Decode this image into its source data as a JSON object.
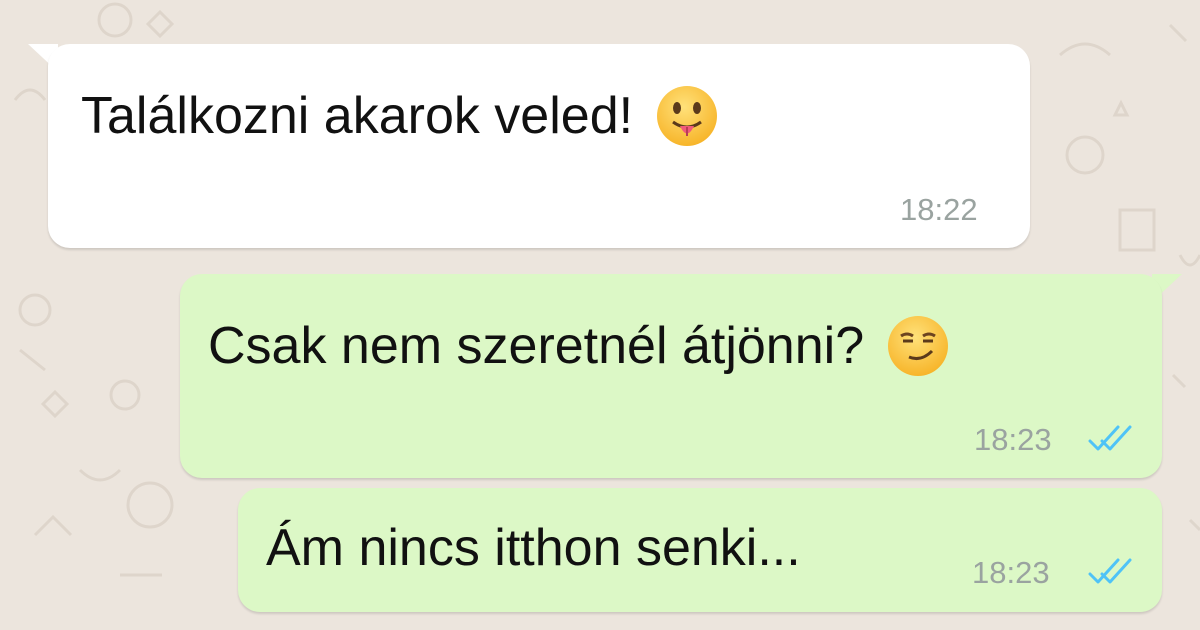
{
  "conversation": {
    "messages": [
      {
        "direction": "incoming",
        "text": "Találkozni akarok veled!",
        "emoji": "face-with-tongue-emoji",
        "time": "18:22"
      },
      {
        "direction": "outgoing",
        "text": "Csak nem szeretnél átjönni?",
        "emoji": "smirking-face-emoji",
        "time": "18:23",
        "status": "read-double-check-icon"
      },
      {
        "direction": "outgoing",
        "text": "Ám nincs itthon senki...",
        "time": "18:23",
        "status": "read-double-check-icon"
      }
    ]
  },
  "colors": {
    "background": "#ece5dd",
    "incoming_bubble": "#ffffff",
    "outgoing_bubble": "#dcf8c6",
    "timestamp": "#9aa3a0",
    "read_ticks": "#4fc3f7"
  }
}
